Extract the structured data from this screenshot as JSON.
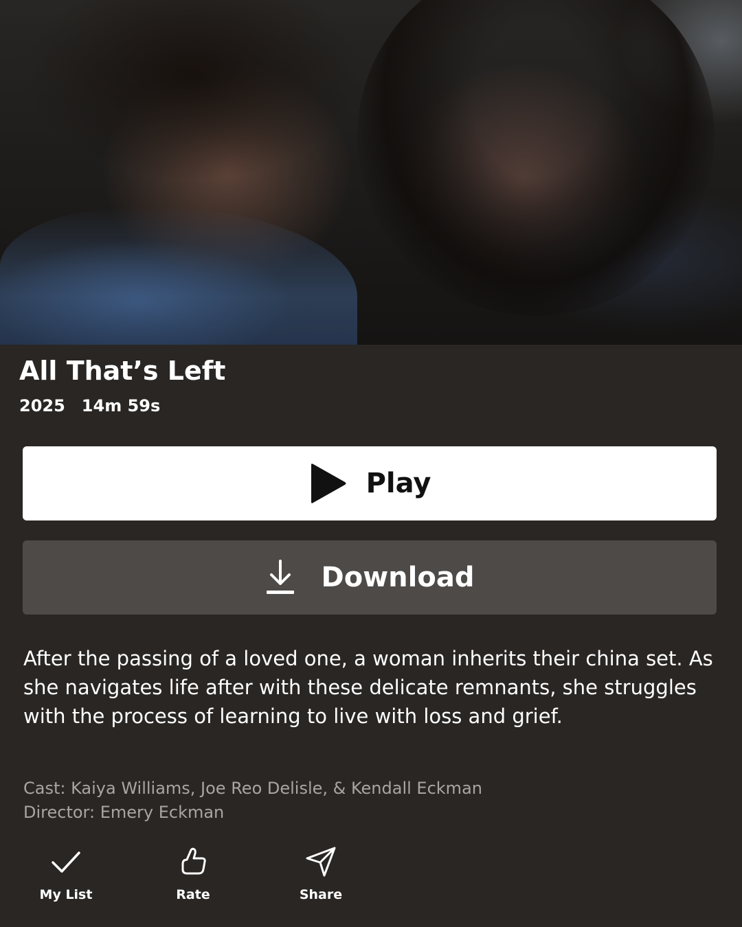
{
  "hero": {
    "image_alt": "Two people leaning heads together"
  },
  "title": "All That’s Left",
  "meta": {
    "year": "2025",
    "duration": "14m 59s"
  },
  "buttons": {
    "play_label": "Play",
    "download_label": "Download"
  },
  "synopsis": "After the passing of a loved one, a woman inherits their china set. As she navigates life after with these delicate remnants, she struggles with the process of learning to live with loss and grief.",
  "credits": {
    "cast": "Cast: Kaiya Williams, Joe Reo Delisle, & Kendall Eckman",
    "director": "Director: Emery Eckman"
  },
  "actions": {
    "my_list": "My List",
    "rate": "Rate",
    "share": "Share"
  },
  "icons": {
    "play": "play-icon",
    "download": "download-icon",
    "check": "check-icon",
    "thumb": "thumbs-up-icon",
    "share": "send-icon"
  },
  "colors": {
    "background": "#292624",
    "play_button": "#ffffff",
    "download_button": "#4d4a48",
    "credits_text": "#a9a5a2"
  }
}
